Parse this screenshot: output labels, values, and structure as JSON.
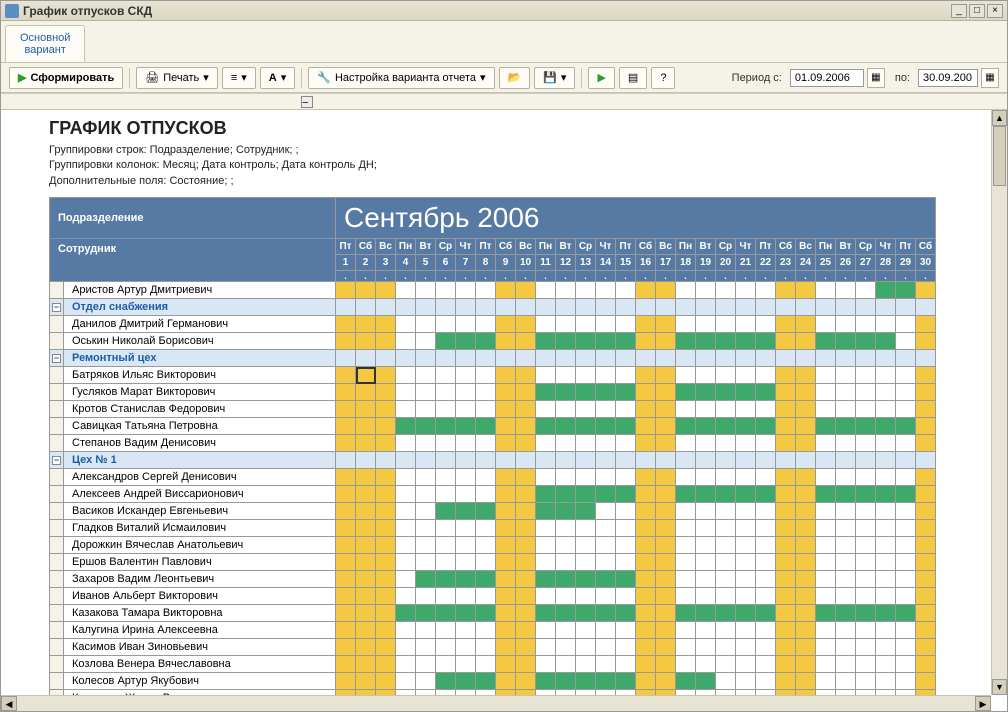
{
  "window": {
    "title": "График отпусков СКД"
  },
  "tabs": {
    "main": "Основной\nвариант"
  },
  "toolbar": {
    "generate": "Сформировать",
    "print": "Печать",
    "settings": "Настройка варианта отчета",
    "period_from_label": "Период с:",
    "period_to_label": "по:",
    "period_from": "01.09.2006",
    "period_to": "30.09.200"
  },
  "report_header": {
    "title": "ГРАФИК ОТПУСКОВ",
    "line1": "Группировки строк: Подразделение; Сотрудник;  ;",
    "line2": "Группировки колонок: Месяц; Дата контроль; Дата контроль ДН;",
    "line3": "Дополнительные поля: Состояние;  ;"
  },
  "grid_header": {
    "left_top": "Подразделение",
    "left_bottom": "Сотрудник",
    "month": "Сентябрь 2006"
  },
  "days": [
    {
      "n": "1",
      "w": "Пт",
      "t": "y"
    },
    {
      "n": "2",
      "w": "Сб",
      "t": "y"
    },
    {
      "n": "3",
      "w": "Вс",
      "t": "y"
    },
    {
      "n": "4",
      "w": "Пн",
      "t": ""
    },
    {
      "n": "5",
      "w": "Вт",
      "t": ""
    },
    {
      "n": "6",
      "w": "Ср",
      "t": ""
    },
    {
      "n": "7",
      "w": "Чт",
      "t": ""
    },
    {
      "n": "8",
      "w": "Пт",
      "t": ""
    },
    {
      "n": "9",
      "w": "Сб",
      "t": "y"
    },
    {
      "n": "10",
      "w": "Вс",
      "t": "y"
    },
    {
      "n": "11",
      "w": "Пн",
      "t": ""
    },
    {
      "n": "12",
      "w": "Вт",
      "t": ""
    },
    {
      "n": "13",
      "w": "Ср",
      "t": ""
    },
    {
      "n": "14",
      "w": "Чт",
      "t": ""
    },
    {
      "n": "15",
      "w": "Пт",
      "t": ""
    },
    {
      "n": "16",
      "w": "Сб",
      "t": "y"
    },
    {
      "n": "17",
      "w": "Вс",
      "t": "y"
    },
    {
      "n": "18",
      "w": "Пн",
      "t": ""
    },
    {
      "n": "19",
      "w": "Вт",
      "t": ""
    },
    {
      "n": "20",
      "w": "Ср",
      "t": ""
    },
    {
      "n": "21",
      "w": "Чт",
      "t": ""
    },
    {
      "n": "22",
      "w": "Пт",
      "t": ""
    },
    {
      "n": "23",
      "w": "Сб",
      "t": "y"
    },
    {
      "n": "24",
      "w": "Вс",
      "t": "y"
    },
    {
      "n": "25",
      "w": "Пн",
      "t": ""
    },
    {
      "n": "26",
      "w": "Вт",
      "t": ""
    },
    {
      "n": "27",
      "w": "Ср",
      "t": ""
    },
    {
      "n": "28",
      "w": "Чт",
      "t": ""
    },
    {
      "n": "29",
      "w": "Пт",
      "t": ""
    },
    {
      "n": "30",
      "w": "Сб",
      "t": "y"
    }
  ],
  "rows": [
    {
      "type": "emp",
      "name": "Аристов Артур Дмитриевич",
      "cells": "yyy.....yy.....yy.....yy...vvy"
    },
    {
      "type": "dept",
      "name": "Отдел снабжения",
      "exp": "-"
    },
    {
      "type": "emp",
      "name": "Данилов Дмитрий Германович",
      "cells": "yyy.....yy.....yy.....yy.....y"
    },
    {
      "type": "emp",
      "name": "Оськин Николай Борисович",
      "cells": "yyy..vvvyyvvvvvyyvvvvvyyvvvv.y"
    },
    {
      "type": "dept",
      "name": "Ремонтный цех",
      "exp": "-"
    },
    {
      "type": "emp",
      "name": "Батряков Ильяс Викторович",
      "cells": "ySy.....yy.....yy.....yy.....y"
    },
    {
      "type": "emp",
      "name": "Гусляков Марат Викторович",
      "cells": "yyy.....yyvvvvvyyvvvvvyy.....y"
    },
    {
      "type": "emp",
      "name": "Кротов Станислав Федорович",
      "cells": "yyy.....yy.....yy.....yy.....y"
    },
    {
      "type": "emp",
      "name": "Савицкая Татьяна Петровна",
      "cells": "yyyvvvvvyyvvvvvyyvvvvvyyvvvvvy"
    },
    {
      "type": "emp",
      "name": "Степанов Вадим Денисович",
      "cells": "yyy.....yy.....yy.....yy.....y"
    },
    {
      "type": "dept",
      "name": "Цех № 1",
      "exp": "-"
    },
    {
      "type": "emp",
      "name": "Александров Сергей Денисович",
      "cells": "yyy.....yy.....yy.....yy.....y"
    },
    {
      "type": "emp",
      "name": "Алексеев Андрей Виссарионович",
      "cells": "yyy.....yyvvvvvyyvvvvvyyvvvvvy"
    },
    {
      "type": "emp",
      "name": "Васиков Искандер Евгеньевич",
      "cells": "yyy..vvvyyvvv..yy.....yy.....y"
    },
    {
      "type": "emp",
      "name": "Гладков Виталий Исмаилович",
      "cells": "yyy.....yy.....yy.....yy.....y"
    },
    {
      "type": "emp",
      "name": "Дорожкин Вячеслав Анатольевич",
      "cells": "yyy.....yy.....yy.....yy.....y"
    },
    {
      "type": "emp",
      "name": "Ершов Валентин Павлович",
      "cells": "yyy.....yy.....yy.....yy.....y"
    },
    {
      "type": "emp",
      "name": "Захаров Вадим Леонтьевич",
      "cells": "yyy.vvvvyyvvvvvyy.....yy.....y"
    },
    {
      "type": "emp",
      "name": "Иванов Альберт Викторович",
      "cells": "yyy.....yy.....yy.....yy.....y"
    },
    {
      "type": "emp",
      "name": "Казакова Тамара Викторовна",
      "cells": "yyyvvvvvyyvvvvvyyvvvvvyyvvvvvy"
    },
    {
      "type": "emp",
      "name": "Калугина Ирина Алексеевна",
      "cells": "yyy.....yy.....yy.....yy.....y"
    },
    {
      "type": "emp",
      "name": "Касимов Иван Зиновьевич",
      "cells": "yyy.....yy.....yy.....yy.....y"
    },
    {
      "type": "emp",
      "name": "Козлова Венера Вячеславовна",
      "cells": "yyy.....yy.....yy.....yy.....y"
    },
    {
      "type": "emp",
      "name": "Колесов Артур Якубович",
      "cells": "yyy..vvvyyvvvvvyyvv...yy.....y"
    },
    {
      "type": "emp",
      "name": "Косырева Жанна Вячеславовна",
      "cells": "yyy.....yy.....yy.....yy.....y"
    }
  ]
}
